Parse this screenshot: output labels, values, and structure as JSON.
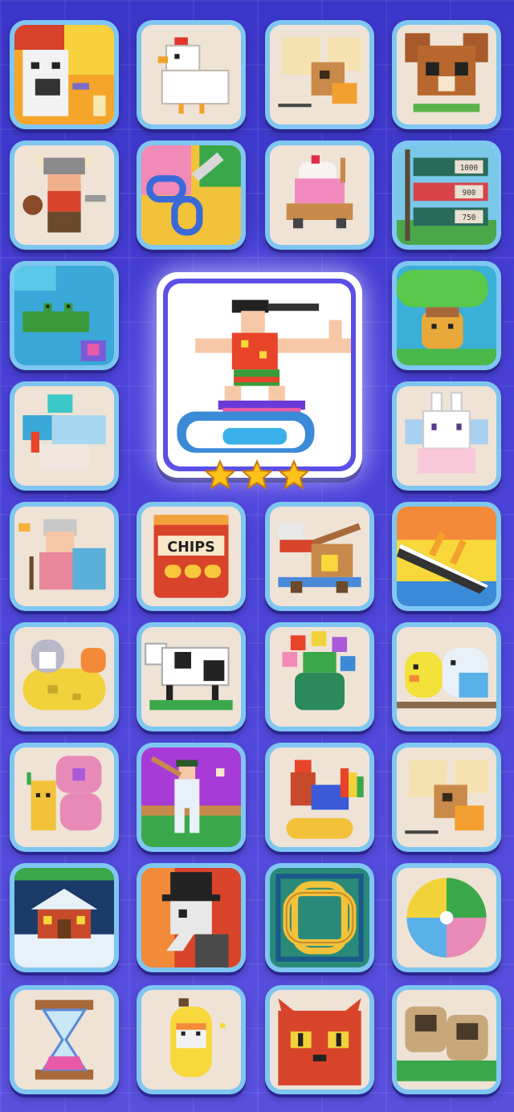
{
  "screen": "puzzle-gallery",
  "featured": {
    "name": "surfer",
    "stars_earned": 3,
    "stars_total": 3
  },
  "tiles": [
    {
      "name": "angry-cat"
    },
    {
      "name": "chicken"
    },
    {
      "name": "moth"
    },
    {
      "name": "chihuahua"
    },
    {
      "name": "viking"
    },
    {
      "name": "scissors"
    },
    {
      "name": "cupcake-cart"
    },
    {
      "name": "score-signs",
      "labels": [
        "1000",
        "900",
        "750"
      ]
    },
    {
      "name": "crocodile"
    },
    {
      "name": "leaf-umbrella-bird"
    },
    {
      "name": "hummingbird"
    },
    {
      "name": "bunny"
    },
    {
      "name": "grandma"
    },
    {
      "name": "chips-bag",
      "label": "CHIPS"
    },
    {
      "name": "catapult-cat"
    },
    {
      "name": "sinking-ship"
    },
    {
      "name": "moon-penguin"
    },
    {
      "name": "cow"
    },
    {
      "name": "flower-bouquet"
    },
    {
      "name": "birds"
    },
    {
      "name": "butterfly"
    },
    {
      "name": "cricket-player"
    },
    {
      "name": "rooster"
    },
    {
      "name": "moth-2"
    },
    {
      "name": "snowy-cabin"
    },
    {
      "name": "plague-doctor"
    },
    {
      "name": "celtic-knot"
    },
    {
      "name": "beach-ball"
    },
    {
      "name": "hourglass"
    },
    {
      "name": "banana-cat"
    },
    {
      "name": "red-cat"
    },
    {
      "name": "pug-pillows"
    }
  ],
  "colors": {
    "tile_border": "#7fc6f2",
    "tile_bg": "#efe3d6",
    "featured_ring": "#5b4fe6",
    "star": "#ffc21a",
    "background": "#4a42d8"
  }
}
